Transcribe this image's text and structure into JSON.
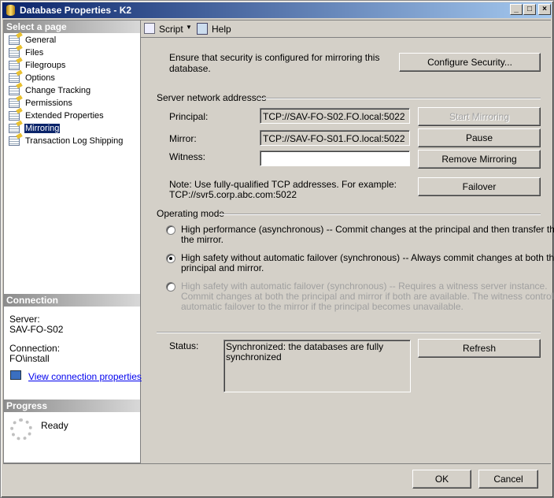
{
  "window": {
    "title": "Database Properties - K2",
    "minimize": "_",
    "maximize": "□",
    "close": "×"
  },
  "sidebar": {
    "header": "Select a page",
    "items": [
      {
        "label": "General"
      },
      {
        "label": "Files"
      },
      {
        "label": "Filegroups"
      },
      {
        "label": "Options"
      },
      {
        "label": "Change Tracking"
      },
      {
        "label": "Permissions"
      },
      {
        "label": "Extended Properties"
      },
      {
        "label": "Mirroring",
        "selected": true
      },
      {
        "label": "Transaction Log Shipping"
      }
    ]
  },
  "connection": {
    "header": "Connection",
    "server_label": "Server:",
    "server": "SAV-FO-S02",
    "connection_label": "Connection:",
    "connection": "FO\\install",
    "link": "View connection properties"
  },
  "progress": {
    "header": "Progress",
    "status": "Ready"
  },
  "toolbar": {
    "script": "Script",
    "help": "Help"
  },
  "mirroring": {
    "security_text": "Ensure that security is configured for mirroring this database.",
    "configure_security": "Configure Security...",
    "server_group": "Server network addresses",
    "principal_label": "Principal:",
    "principal": "TCP://SAV-FO-S02.FO.local:5022",
    "mirror_label": "Mirror:",
    "mirror": "TCP://SAV-FO-S01.FO.local:5022",
    "witness_label": "Witness:",
    "witness": "",
    "start_mirroring": "Start Mirroring",
    "pause": "Pause",
    "remove_mirroring": "Remove Mirroring",
    "failover": "Failover",
    "note": "Note: Use fully-qualified TCP addresses. For example:",
    "note_example": "TCP://svr5.corp.abc.com:5022",
    "operating_mode": "Operating mode",
    "modes": [
      {
        "l1": "High performance (asynchronous) -- Commit changes at the principal and then transfer them to",
        "l2": "the mirror.",
        "selected": false,
        "enabled": true
      },
      {
        "l1": "High safety without automatic failover (synchronous) -- Always commit changes at both the",
        "l2": "principal and mirror.",
        "selected": true,
        "enabled": true
      },
      {
        "l1": "High safety with automatic failover (synchronous) -- Requires a witness server instance.",
        "l2": "Commit changes at both the principal and mirror if both are available. The witness controls",
        "l3": "automatic failover to the mirror if the principal becomes unavailable.",
        "selected": false,
        "enabled": false
      }
    ],
    "status_label": "Status:",
    "status": "Synchronized: the databases are fully synchronized",
    "refresh": "Refresh"
  },
  "footer": {
    "ok": "OK",
    "cancel": "Cancel"
  }
}
